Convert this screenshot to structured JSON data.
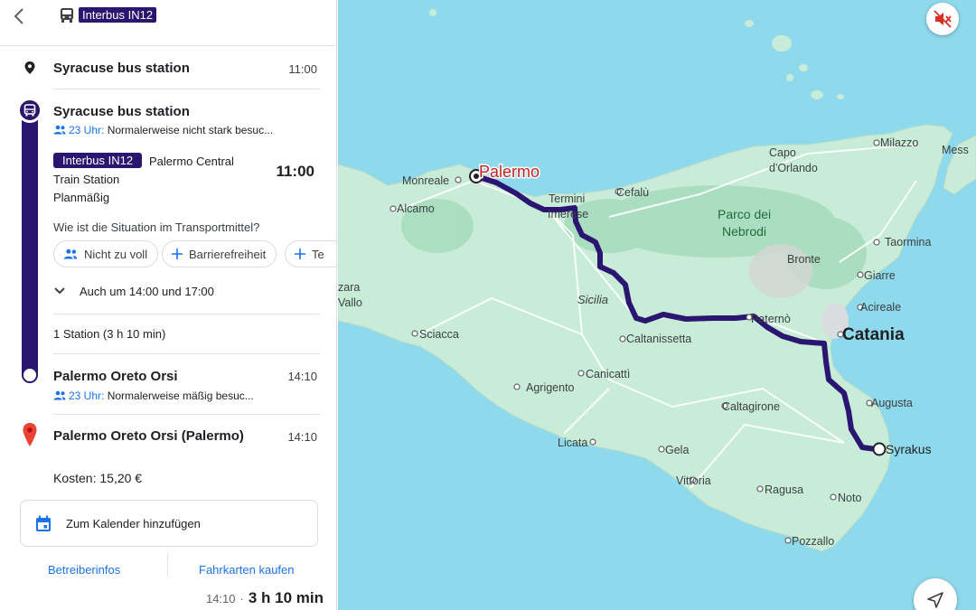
{
  "header": {
    "line_badge": "Interbus IN12"
  },
  "origin": {
    "name": "Syracuse bus station",
    "time": "11:00"
  },
  "departure": {
    "stop": "Syracuse bus station",
    "crowd_time": "23 Uhr:",
    "crowd_text": "Normalerweise nicht stark besuc...",
    "line_badge": "Interbus IN12",
    "destination_l1": "Palermo Central",
    "destination_l2": "Train Station",
    "status": "Planmäßig",
    "time": "11:00"
  },
  "feedback": {
    "question": "Wie ist die Situation im Transportmittel?",
    "chips": [
      "Nicht zu voll",
      "Barrierefreiheit",
      "Te"
    ]
  },
  "also_at": "Auch um 14:00 und 17:00",
  "stops_summary": "1 Station (3 h 10 min)",
  "arrival": {
    "stop": "Palermo Oreto Orsi",
    "time": "14:10",
    "crowd_time": "23 Uhr:",
    "crowd_text": "Normalerweise mäßig besuc..."
  },
  "destination": {
    "name": "Palermo Oreto Orsi (Palermo)",
    "time": "14:10"
  },
  "cost": "Kosten: 15,20 €",
  "calendar_label": "Zum Kalender hinzufügen",
  "links": {
    "operator": "Betreiberinfos",
    "tickets": "Fahrkarten kaufen"
  },
  "footer": {
    "arrival_time": "14:10",
    "separator": "·",
    "duration": "3 h 10 min"
  },
  "map": {
    "colors": {
      "sea": "#8fd9ec",
      "land": "#c8ecd8",
      "route": "#2a1670"
    },
    "labels": {
      "palermo": "Palermo",
      "monreale": "Monreale",
      "alcamo": "Alcamo",
      "termini1": "Termini",
      "termini2": "Imerese",
      "cefalu": "Cefalù",
      "capo1": "Capo",
      "capo2": "d'Orlando",
      "milazzo": "Milazzo",
      "messina": "Mess",
      "nebrodi1": "Parco dei",
      "nebrodi2": "Nebrodi",
      "taormina": "Taormina",
      "bronte": "Bronte",
      "giarre": "Giarre",
      "acireale": "Acireale",
      "catania": "Catania",
      "paterno": "Paternò",
      "sicilia": "Sicilia",
      "caltanissetta": "Caltanissetta",
      "sciacca": "Sciacca",
      "mazara": "zara",
      "vallo": "Vallo",
      "canicatti": "Canicattì",
      "agrigento": "Agrigento",
      "caltagirone": "Caltagirone",
      "augusta": "Augusta",
      "syrakus": "Syrakus",
      "licata": "Licata",
      "gela": "Gela",
      "vittoria": "Vittoria",
      "ragusa": "Ragusa",
      "noto": "Noto",
      "pozzallo": "Pozzallo"
    }
  }
}
